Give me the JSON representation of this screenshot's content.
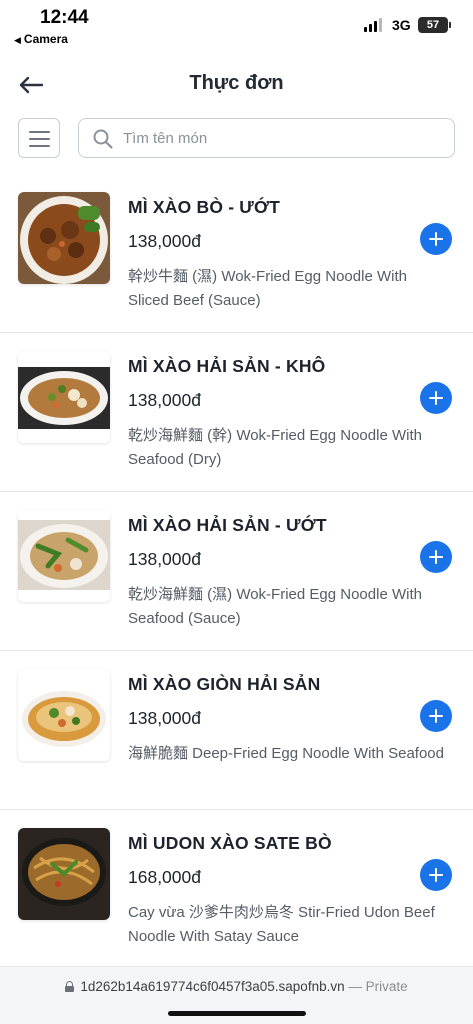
{
  "status_bar": {
    "time": "12:44",
    "back_app": "Camera",
    "network": "3G",
    "battery": "57"
  },
  "header": {
    "title": "Thực đơn"
  },
  "search": {
    "placeholder": "Tìm tên món"
  },
  "menu": {
    "items": [
      {
        "name": "MÌ XÀO BÒ - ƯỚT",
        "price": "138,000đ",
        "description": "幹炒牛麵 (濕) Wok-Fried Egg Noodle With Sliced Beef (Sauce)",
        "image": "beef-noodle-sauce-photo"
      },
      {
        "name": "MÌ XÀO HẢI SẢN - KHÔ",
        "price": "138,000đ",
        "description": "乾炒海鮮麵 (幹) Wok-Fried Egg Noodle With Seafood (Dry)",
        "image": "seafood-noodle-dry-photo"
      },
      {
        "name": "MÌ XÀO HẢI SẢN - ƯỚT",
        "price": "138,000đ",
        "description": "乾炒海鮮麵 (濕) Wok-Fried Egg Noodle With Seafood (Sauce)",
        "image": "seafood-noodle-sauce-photo"
      },
      {
        "name": "MÌ XÀO GIÒN HẢI SẢN",
        "price": "138,000đ",
        "description": "海鮮脆麵 Deep-Fried Egg Noodle With Seafood",
        "image": "crispy-seafood-noodle-photo"
      },
      {
        "name": "MÌ UDON XÀO SATE BÒ",
        "price": "168,000đ",
        "description": "Cay vừa 沙爹牛肉炒烏冬 Stir-Fried Udon Beef Noodle With Satay Sauce",
        "image": "udon-satay-beef-photo"
      }
    ]
  },
  "url_bar": {
    "url": "1d262b14a619774c6f0457f3a05.sapofnb.vn",
    "suffix": "— Private"
  },
  "colors": {
    "accent": "#1a73e8",
    "title_text": "#222a33",
    "description_text": "#555c66",
    "divider": "#e3e6ea"
  }
}
